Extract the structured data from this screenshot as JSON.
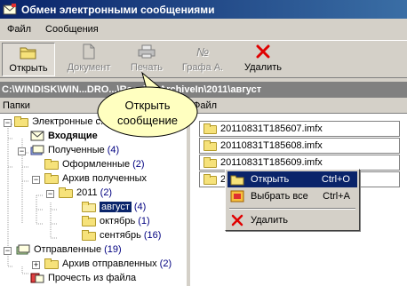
{
  "window": {
    "title": "Обмен электронными сообщениями"
  },
  "menu": {
    "items": [
      "Файл",
      "Сообщения"
    ]
  },
  "toolbar": {
    "open_label": "Открыть",
    "document_label": "Документ",
    "print_label": "Печать",
    "grafa_label": "Графа А.",
    "grafa_icon_text": "№",
    "delete_label": "Удалить"
  },
  "path": {
    "text": "C:\\WINDISK\\WIN...DRO...\\Receive\\ArchiveIn\\2011\\август"
  },
  "left_pane": {
    "header": "Папки",
    "tree": [
      {
        "label": "Электронные с...",
        "count": ""
      },
      {
        "label": "Входящие",
        "count": ""
      },
      {
        "label": "Полученные",
        "count": "(4)"
      },
      {
        "label": "Оформленные",
        "count": "(2)"
      },
      {
        "label": "Архив полученных",
        "count": ""
      },
      {
        "label": "2011",
        "count": "(2)"
      },
      {
        "label": "август",
        "count": "(4)"
      },
      {
        "label": "октябрь",
        "count": "(1)"
      },
      {
        "label": "сентябрь",
        "count": "(16)"
      },
      {
        "label": "Отправленные",
        "count": "(19)"
      },
      {
        "label": "Архив отправленных",
        "count": "(2)"
      },
      {
        "label": "Прочесть из файла",
        "count": ""
      }
    ]
  },
  "right_pane": {
    "header": "Файл",
    "files": [
      "20110831T185607.imfx",
      "20110831T185608.imfx",
      "20110831T185609.imfx",
      "2"
    ]
  },
  "context_menu": {
    "items": [
      {
        "label": "Открыть",
        "shortcut": "Ctrl+O"
      },
      {
        "label": "Выбрать все",
        "shortcut": "Ctrl+A"
      },
      {
        "label": "Удалить",
        "shortcut": ""
      }
    ]
  },
  "callout": {
    "line1": "Открыть",
    "line2": "сообщение"
  },
  "colors": {
    "title_bar": "#0a246a",
    "selection": "#0a246a",
    "path_bar": "#808080",
    "callout_fill": "#ffffc0",
    "delete_red": "#e00000"
  }
}
